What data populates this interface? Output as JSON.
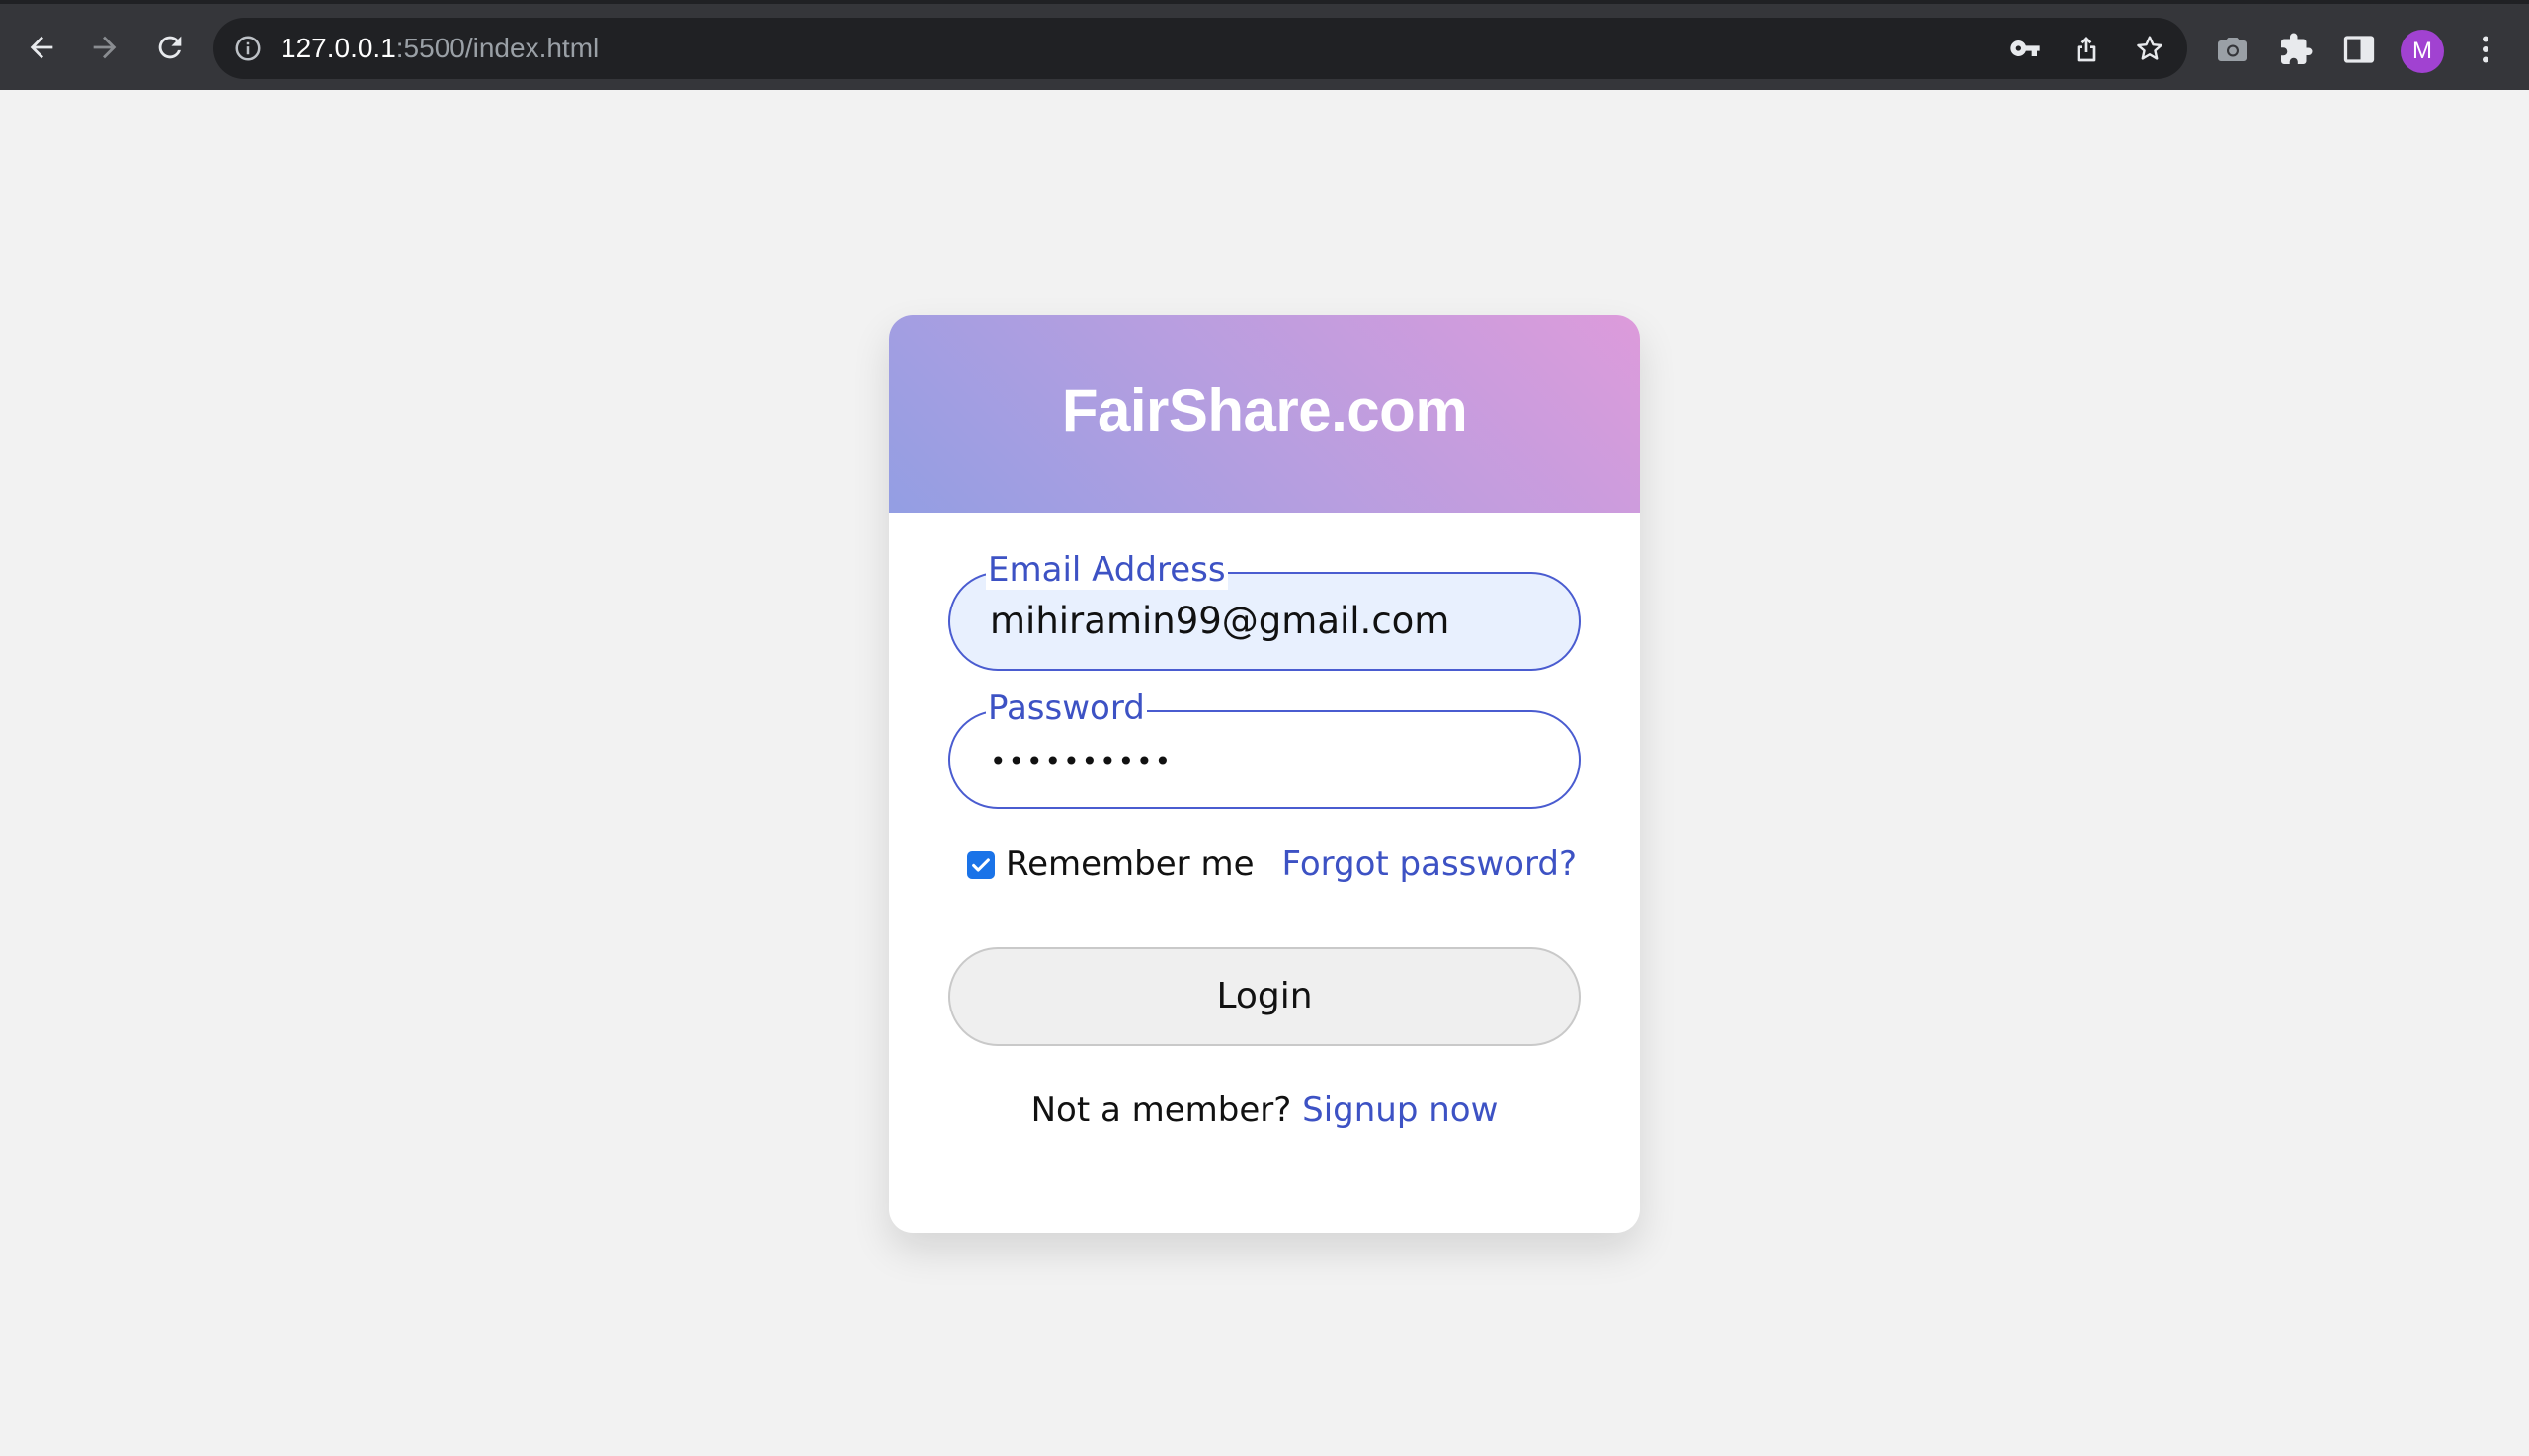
{
  "browser": {
    "url_host": "127.0.0.1",
    "url_path": ":5500/index.html",
    "profile_initial": "M",
    "icons": {
      "back": "arrow-left-icon",
      "forward": "arrow-right-icon",
      "reload": "reload-icon",
      "info": "info-icon",
      "key": "key-icon",
      "share": "share-icon",
      "bookmark": "star-icon",
      "screenshot": "camera-icon",
      "extensions": "puzzle-icon",
      "side_panel": "side-panel-icon",
      "menu": "more-vertical-icon"
    },
    "colors": {
      "toolbar": "#35363a",
      "omnibox": "#202124",
      "avatar": "#a142d1"
    }
  },
  "login": {
    "title": "FairShare.com",
    "email_label": "Email Address",
    "email_value": "mihiramin99@gmail.com",
    "password_label": "Password",
    "password_value": "••••••••••",
    "remember_label": "Remember me",
    "remember_checked": true,
    "forgot_label": "Forgot password?",
    "login_button": "Login",
    "signup_prompt": "Not a member?",
    "signup_link": "Signup now",
    "colors": {
      "accent": "#3d52c4",
      "header_gradient_start": "#939ee3",
      "header_gradient_end": "#dd9bdb",
      "page_background": "#f2f2f2"
    }
  }
}
